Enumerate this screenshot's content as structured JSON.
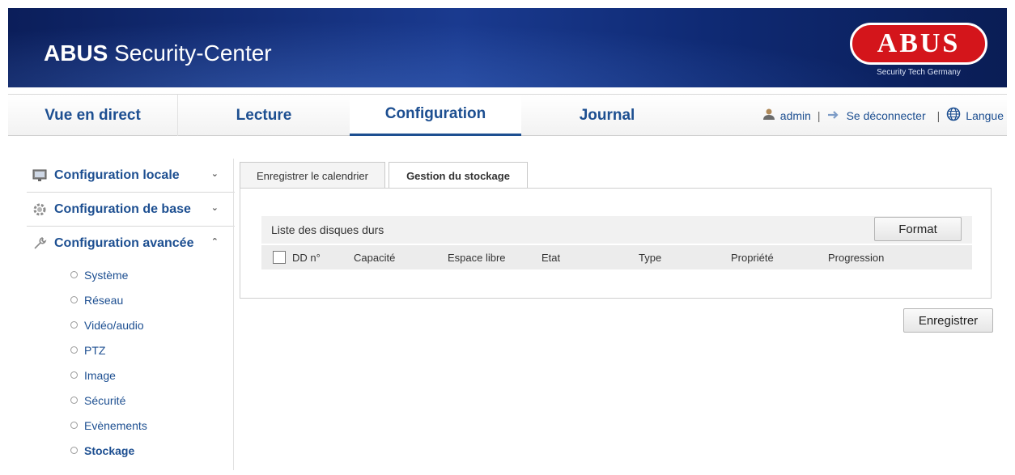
{
  "header": {
    "title_bold": "ABUS",
    "title_rest": " Security-Center",
    "logo_text": "ABUS",
    "logo_tagline": "Security Tech Germany"
  },
  "nav": {
    "tabs": [
      {
        "label": "Vue en direct"
      },
      {
        "label": "Lecture"
      },
      {
        "label": "Configuration",
        "active": true
      },
      {
        "label": "Journal"
      }
    ],
    "user": "admin",
    "separator": "|",
    "logout": "Se déconnecter",
    "language": "Langue"
  },
  "sidebar": {
    "sections": [
      {
        "label": "Configuration locale",
        "chevron": "⌄",
        "icon": "monitor-icon"
      },
      {
        "label": "Configuration de base",
        "chevron": "⌄",
        "icon": "gear-icon"
      },
      {
        "label": "Configuration avancée",
        "chevron": "⌃",
        "icon": "wrench-icon"
      }
    ],
    "items": [
      {
        "label": "Système"
      },
      {
        "label": "Réseau"
      },
      {
        "label": "Vidéo/audio"
      },
      {
        "label": "PTZ"
      },
      {
        "label": "Image"
      },
      {
        "label": "Sécurité"
      },
      {
        "label": "Evènements"
      },
      {
        "label": "Stockage",
        "active": true
      }
    ]
  },
  "tabs": [
    {
      "label": "Enregistrer le calendrier"
    },
    {
      "label": "Gestion du stockage",
      "active": true
    }
  ],
  "hdd": {
    "title": "Liste des disques durs",
    "format_label": "Format",
    "columns": [
      "DD n°",
      "Capacité",
      "Espace libre",
      "Etat",
      "Type",
      "Propriété",
      "Progression"
    ]
  },
  "save_label": "Enregistrer",
  "colors": {
    "brand_blue": "#1d4f91",
    "banner_dark": "#0b1e5a",
    "logo_red": "#d4151b"
  }
}
